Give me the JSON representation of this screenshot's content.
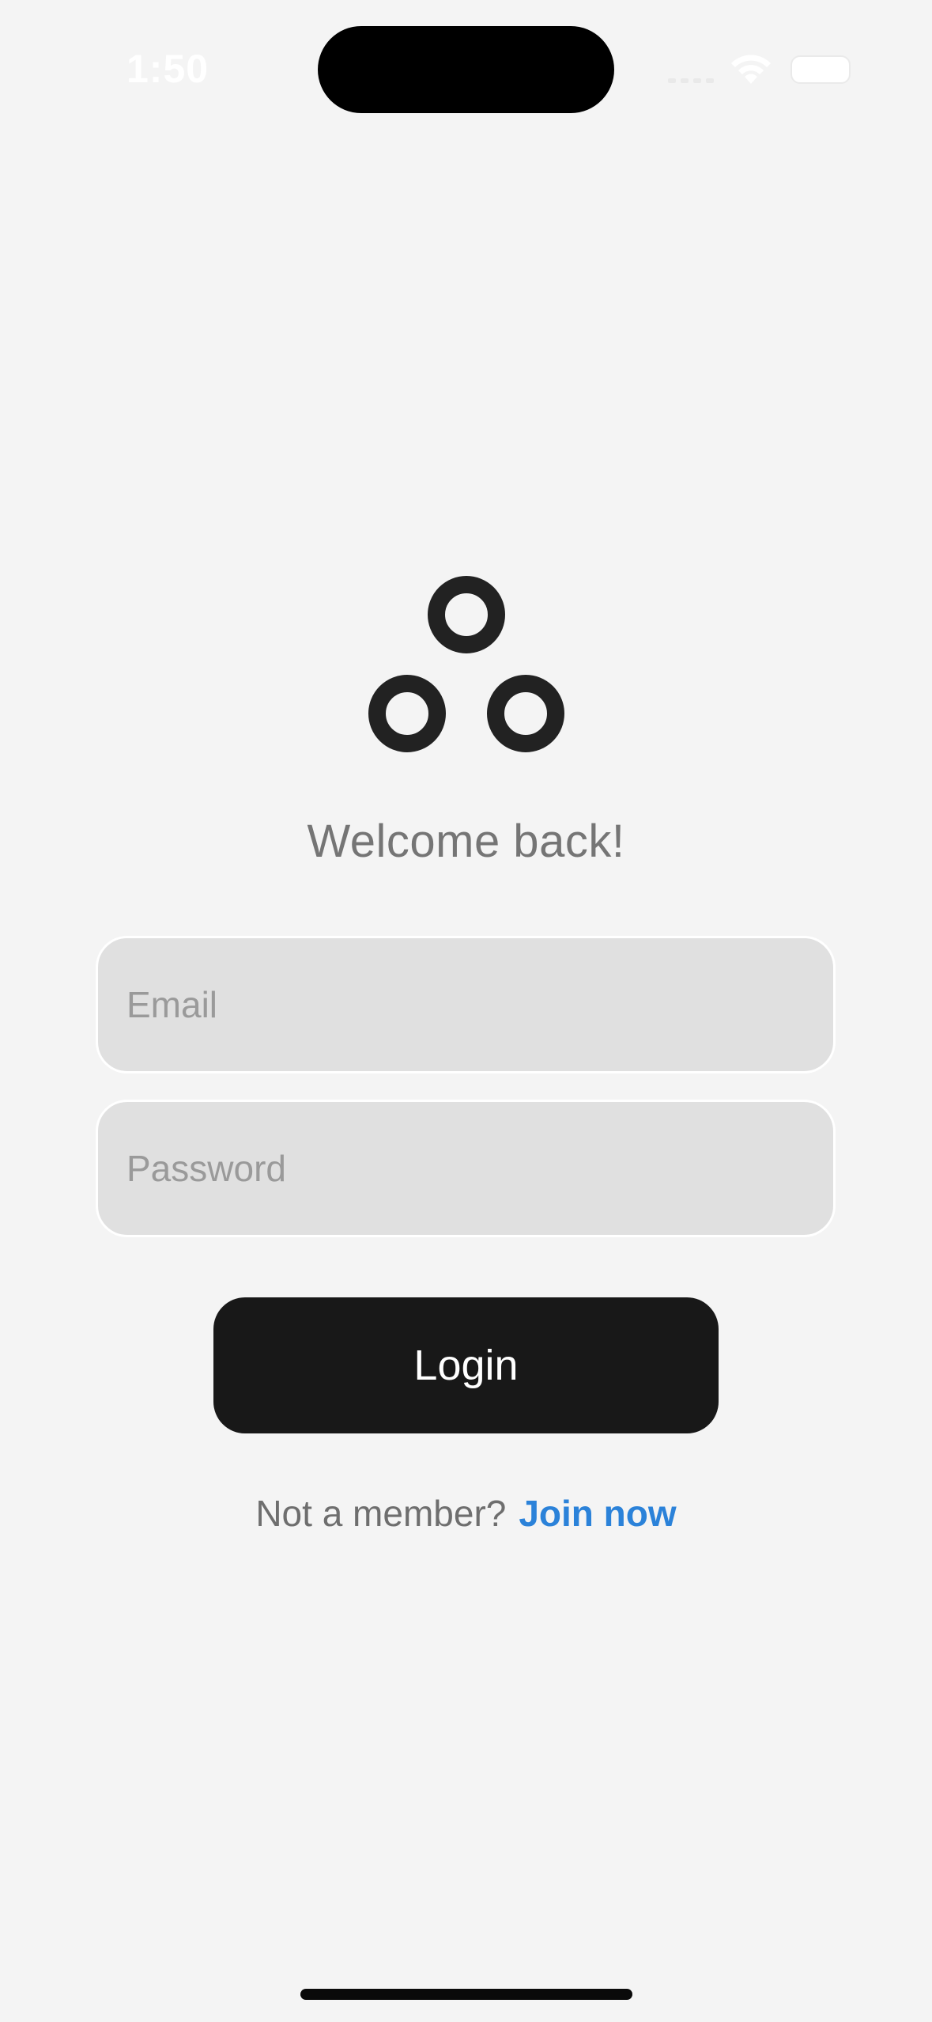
{
  "status_bar": {
    "time": "1:50",
    "icons": [
      "cellular-signal-icon",
      "wifi-icon",
      "battery-icon"
    ]
  },
  "logo": {
    "icon": "three-rings-logo-icon"
  },
  "welcome": {
    "title": "Welcome back!"
  },
  "form": {
    "email": {
      "value": "",
      "placeholder": "Email"
    },
    "password": {
      "value": "",
      "placeholder": "Password"
    },
    "login_label": "Login"
  },
  "signup": {
    "prompt": "Not a member?",
    "link_label": "Join now"
  },
  "colors": {
    "background": "#f4f4f4",
    "button": "#181818",
    "link": "#2b82d9",
    "field": "#e0e0e0"
  }
}
